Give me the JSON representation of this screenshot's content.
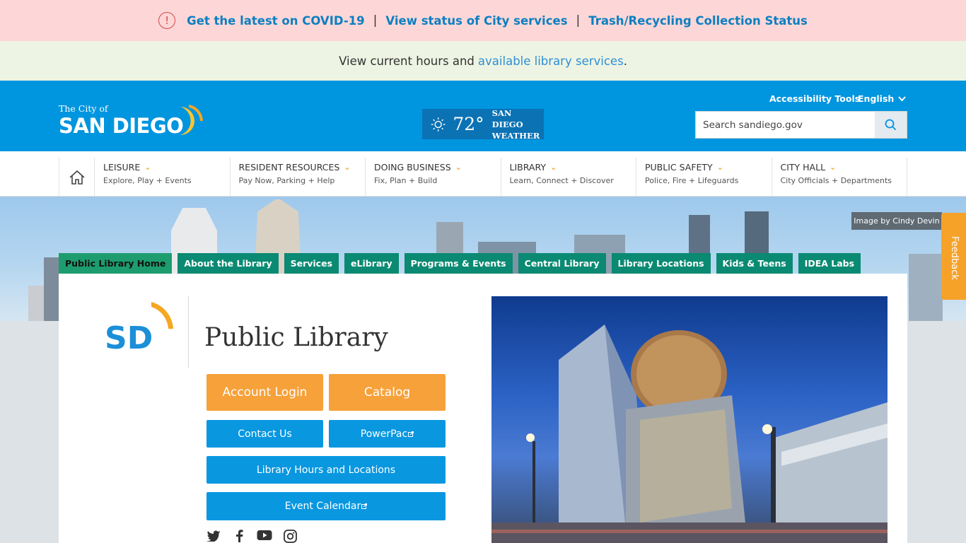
{
  "alert": {
    "link1": "Get the latest on COVID-19",
    "separator1": "|",
    "link2": "View status of City services",
    "separator2": "|",
    "link3": "Trash/Recycling Collection Status"
  },
  "info": {
    "text": "View current hours and",
    "link": "available library services",
    "suffix": "."
  },
  "header": {
    "logo_small": "The City of",
    "logo_big": "SAN DIEGO",
    "weather_temp": "72°",
    "weather_label_line1": "SAN DIEGO",
    "weather_label_line2": "WEATHER",
    "accessibility": "Accessibility Tools",
    "language": "English",
    "search_placeholder": "Search sandiego.gov"
  },
  "nav": {
    "items": [
      {
        "title": "LEISURE",
        "sub": "Explore, Play + Events"
      },
      {
        "title": "RESIDENT RESOURCES",
        "sub": "Pay Now, Parking + Help"
      },
      {
        "title": "DOING BUSINESS",
        "sub": "Fix, Plan + Build"
      },
      {
        "title": "LIBRARY",
        "sub": "Learn, Connect + Discover"
      },
      {
        "title": "PUBLIC SAFETY",
        "sub": "Police, Fire + Lifeguards"
      },
      {
        "title": "CITY HALL",
        "sub": "City Officials + Departments"
      }
    ]
  },
  "hero": {
    "credit": "Image by Cindy Devin"
  },
  "feedback": "Feedback",
  "library_tabs": [
    "Public Library Home",
    "About the Library",
    "Services",
    "eLibrary",
    "Programs & Events",
    "Central Library",
    "Library Locations",
    "Kids & Teens",
    "IDEA Labs"
  ],
  "library": {
    "logo_text": "SD",
    "title": "Public Library",
    "account_login": "Account Login",
    "catalog": "Catalog",
    "contact_us": "Contact Us",
    "powerpac": "PowerPac",
    "hours_locations": "Library Hours and Locations",
    "event_calendar": "Event Calendar"
  },
  "colors": {
    "header_blue": "#0095df",
    "alert_bg": "#fdd7d7",
    "info_bg": "#eef4e3",
    "accent_orange": "#f6a229",
    "tab_green": "#0a8a72",
    "button_blue": "#0997e0"
  }
}
